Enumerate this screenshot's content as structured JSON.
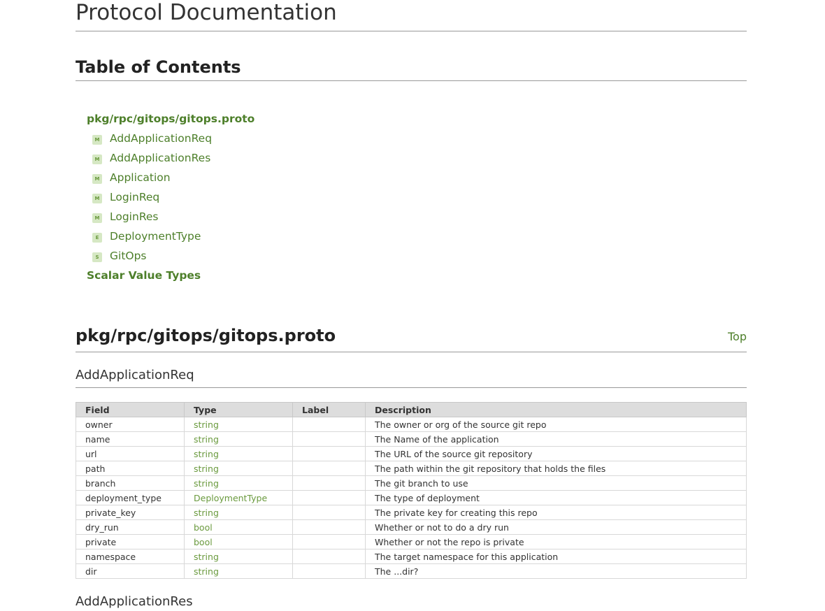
{
  "title": "Protocol Documentation",
  "toc": {
    "heading": "Table of Contents",
    "file": "pkg/rpc/gitops/gitops.proto",
    "items": [
      {
        "badge": "M",
        "label": "AddApplicationReq"
      },
      {
        "badge": "M",
        "label": "AddApplicationRes"
      },
      {
        "badge": "M",
        "label": "Application"
      },
      {
        "badge": "M",
        "label": "LoginReq"
      },
      {
        "badge": "M",
        "label": "LoginRes"
      },
      {
        "badge": "E",
        "label": "DeploymentType"
      },
      {
        "badge": "S",
        "label": "GitOps"
      }
    ],
    "scalar": "Scalar Value Types"
  },
  "file_section": {
    "title": "pkg/rpc/gitops/gitops.proto",
    "top_link": "Top"
  },
  "message": {
    "title": "AddApplicationReq",
    "headers": [
      "Field",
      "Type",
      "Label",
      "Description"
    ],
    "rows": [
      [
        "owner",
        "string",
        "",
        "The owner or org of the source git repo"
      ],
      [
        "name",
        "string",
        "",
        "The Name of the application"
      ],
      [
        "url",
        "string",
        "",
        "The URL of the source git repository"
      ],
      [
        "path",
        "string",
        "",
        "The path within the git repository that holds the files"
      ],
      [
        "branch",
        "string",
        "",
        "The git branch to use"
      ],
      [
        "deployment_type",
        "DeploymentType",
        "",
        "The type of deployment"
      ],
      [
        "private_key",
        "string",
        "",
        "The private key for creating this repo"
      ],
      [
        "dry_run",
        "bool",
        "",
        "Whether or not to do a dry run"
      ],
      [
        "private",
        "bool",
        "",
        "Whether or not the repo is private"
      ],
      [
        "namespace",
        "string",
        "",
        "The target namespace for this application"
      ],
      [
        "dir",
        "string",
        "",
        "The ...dir?"
      ]
    ]
  },
  "next_message": {
    "title": "AddApplicationRes"
  },
  "colors": {
    "link": "#4d7f2a",
    "type_link": "#6a9a3e",
    "badge_bg": "#d6e8c4",
    "header_bg": "#dddddd"
  }
}
